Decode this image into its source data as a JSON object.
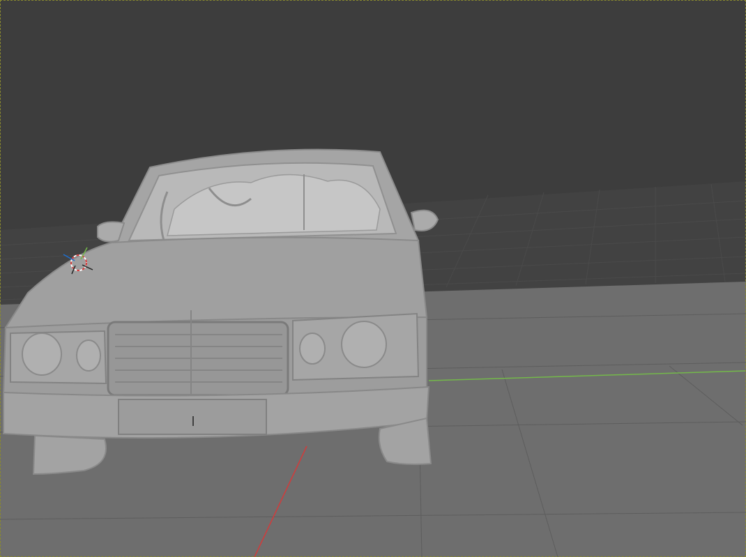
{
  "viewport": {
    "background_color": "#3d3d3d",
    "floor_color": "#6e6e6e",
    "grid_line_color": "#555555",
    "x_axis_color": "#d23b3b",
    "y_axis_color": "#74b94a",
    "mesh_color": "#a8a8a8",
    "frame_border_color": "#8a8a2e"
  },
  "scene": {
    "object_type": "mesh",
    "object_icon": "car-mesh",
    "cursor_icon": "3d-cursor-icon",
    "cursor_colors": [
      "#d23b3b",
      "#ffffff"
    ]
  }
}
